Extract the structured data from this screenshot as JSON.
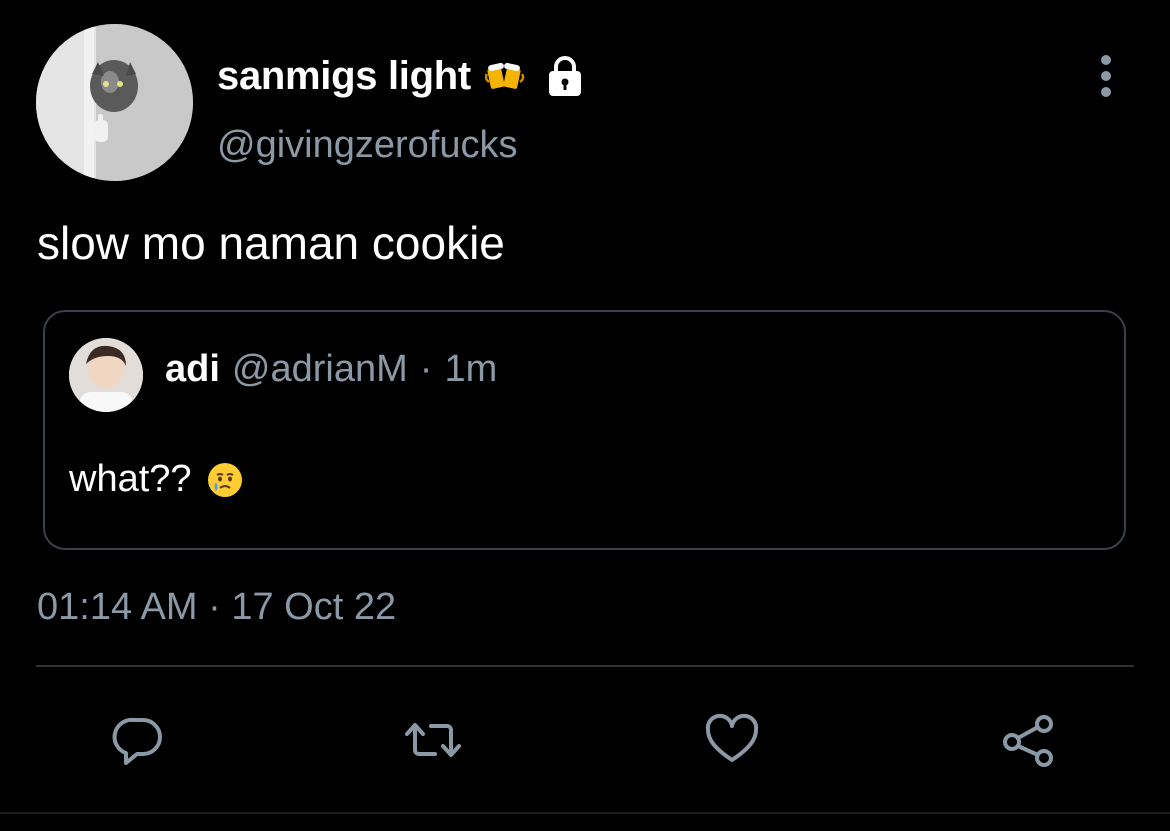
{
  "author": {
    "display_name": "sanmigs light",
    "name_emoji": "beer-mugs-emoji",
    "handle": "@givingzerofucks",
    "protected_icon": "lock-icon"
  },
  "tweet": {
    "text": "slow mo naman cookie",
    "timestamp": "01:14 AM · 17 Oct 22"
  },
  "quoted_tweet": {
    "name": "adi",
    "handle": "@adrianM",
    "separator": "·",
    "time": "1m",
    "text": "what??",
    "text_emoji": "face-holding-back-tears-emoji"
  },
  "actions": [
    {
      "name": "reply",
      "icon": "reply-icon"
    },
    {
      "name": "retweet",
      "icon": "retweet-icon"
    },
    {
      "name": "like",
      "icon": "heart-icon"
    },
    {
      "name": "share",
      "icon": "share-icon"
    }
  ],
  "colors": {
    "background": "#000000",
    "primary_text": "#ffffff",
    "secondary_text": "#8b98a5",
    "border": "#3b4148",
    "divider": "#2f3336"
  }
}
